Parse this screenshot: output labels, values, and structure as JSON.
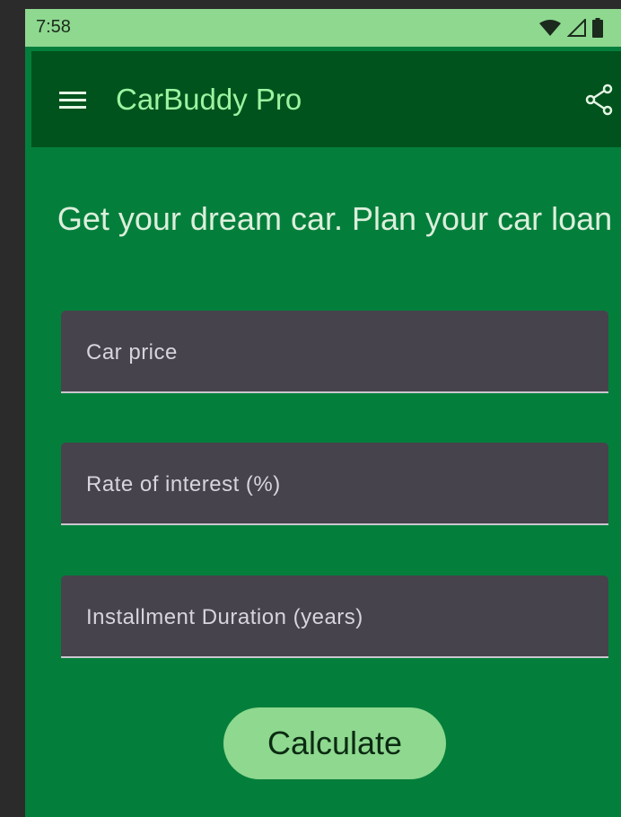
{
  "status_bar": {
    "time": "7:58",
    "icons": [
      "wifi-icon",
      "cellular-signal-icon",
      "battery-icon"
    ]
  },
  "app_bar": {
    "title": "CarBuddy Pro",
    "menu_icon": "hamburger-menu-icon",
    "share_icon": "share-icon"
  },
  "headline": "Get your dream car. Plan your car loan",
  "form": {
    "car_price": {
      "label": "Car price",
      "value": ""
    },
    "rate_of_interest": {
      "label": "Rate of interest (%)",
      "value": ""
    },
    "installment_duration": {
      "label": "Installment Duration (years)",
      "value": ""
    }
  },
  "calculate_button": {
    "label": "Calculate"
  },
  "colors": {
    "status_bar": "#8ed88f",
    "app_bar": "#00531c",
    "background": "#047f3b",
    "title_text": "#9cf3a1",
    "field_background": "#47434d",
    "button": "#8ed88f"
  }
}
